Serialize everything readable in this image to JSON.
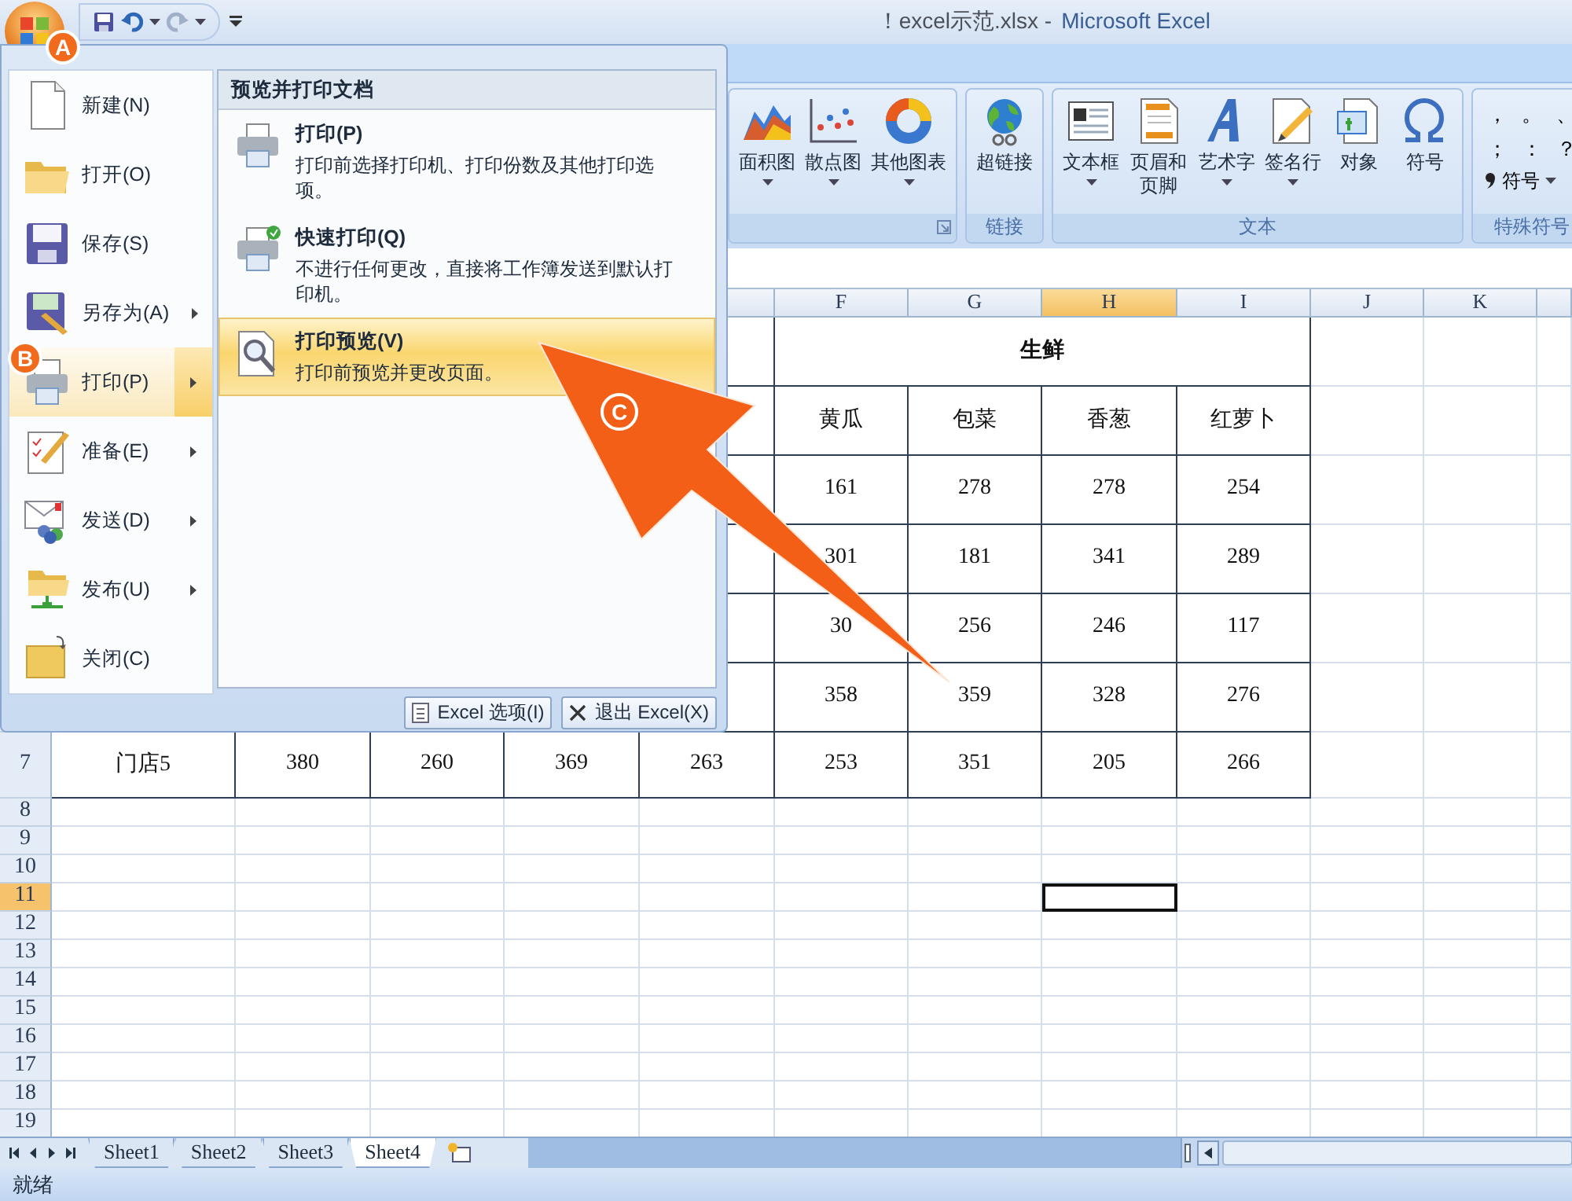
{
  "window": {
    "title_file": "！excel示范.xlsx -",
    "title_app": "Microsoft Excel"
  },
  "ribbon": {
    "groups": [
      {
        "kind": "buttons",
        "launcher": true,
        "buttons": [
          {
            "label": "面积图",
            "dropdown": true
          },
          {
            "label": "散点图",
            "dropdown": true
          },
          {
            "label": "其他图表",
            "dropdown": true
          }
        ]
      },
      {
        "kind": "buttons",
        "label": "链接",
        "buttons": [
          {
            "label": "超链接",
            "dropdown": false
          }
        ]
      },
      {
        "kind": "buttons",
        "label": "文本",
        "buttons": [
          {
            "label": "文本框",
            "dropdown": true
          },
          {
            "label": "页眉和页脚",
            "dropdown": false
          },
          {
            "label": "艺术字",
            "dropdown": true
          },
          {
            "label": "签名行",
            "dropdown": true
          },
          {
            "label": "对象",
            "dropdown": false
          },
          {
            "label": "符号",
            "dropdown": false
          }
        ]
      },
      {
        "kind": "symbols",
        "label": "特殊符号",
        "symbols": [
          "，",
          "。",
          "、",
          "；",
          "：",
          "？"
        ],
        "buttons": [
          {
            "label": "符号",
            "dropdown": true
          }
        ]
      }
    ]
  },
  "file_menu": {
    "commands": [
      {
        "label": "新建(N)",
        "submenu": false,
        "selected": false
      },
      {
        "label": "打开(O)",
        "submenu": false,
        "selected": false
      },
      {
        "label": "保存(S)",
        "submenu": false,
        "selected": false
      },
      {
        "label": "另存为(A)",
        "submenu": true,
        "selected": false
      },
      {
        "label": "打印(P)",
        "submenu": true,
        "selected": true
      },
      {
        "label": "准备(E)",
        "submenu": true,
        "selected": false
      },
      {
        "label": "发送(D)",
        "submenu": true,
        "selected": false
      },
      {
        "label": "发布(U)",
        "submenu": true,
        "selected": false
      },
      {
        "label": "关闭(C)",
        "submenu": false,
        "selected": false
      }
    ],
    "panel": {
      "heading": "预览并打印文档",
      "items": [
        {
          "title": "打印(P)",
          "description": "打印前选择打印机、打印份数及其他打印选项。",
          "selected": false
        },
        {
          "title": "快速打印(Q)",
          "description": "不进行任何更改，直接将工作簿发送到默认打印机。",
          "selected": false
        },
        {
          "title": "打印预览(V)",
          "description": "打印前预览并更改页面。",
          "selected": true
        }
      ]
    },
    "buttons": [
      "Excel 选项(I)",
      "退出 Excel(X)"
    ]
  },
  "sheet": {
    "column_headers": [
      {
        "label": "F",
        "selected": false
      },
      {
        "label": "G",
        "selected": false
      },
      {
        "label": "H",
        "selected": true
      },
      {
        "label": "I",
        "selected": false
      },
      {
        "label": "J",
        "selected": false
      },
      {
        "label": "K",
        "selected": false
      }
    ],
    "row_headers": [
      {
        "label": "7",
        "selected": false
      },
      {
        "label": "8",
        "selected": false
      },
      {
        "label": "9",
        "selected": false
      },
      {
        "label": "10",
        "selected": false
      },
      {
        "label": "11",
        "selected": true
      },
      {
        "label": "12",
        "selected": false
      },
      {
        "label": "13",
        "selected": false
      },
      {
        "label": "14",
        "selected": false
      },
      {
        "label": "15",
        "selected": false
      },
      {
        "label": "16",
        "selected": false
      },
      {
        "label": "17",
        "selected": false
      },
      {
        "label": "18",
        "selected": false
      },
      {
        "label": "19",
        "selected": false
      }
    ],
    "rows": [
      {
        "kind": "merged",
        "text": "生鲜"
      },
      {
        "kind": "cells",
        "cells": [
          null,
          null,
          null,
          null,
          null,
          "黄瓜",
          "包菜",
          "香葱",
          "红萝卜"
        ]
      },
      {
        "kind": "cells",
        "cells": [
          null,
          null,
          null,
          null,
          null,
          "161",
          "278",
          "278",
          "254"
        ]
      },
      {
        "kind": "cells",
        "cells": [
          null,
          null,
          null,
          null,
          null,
          "301",
          "181",
          "341",
          "289"
        ]
      },
      {
        "kind": "cells",
        "cells": [
          null,
          null,
          null,
          null,
          null,
          "30",
          "256",
          "246",
          "117"
        ]
      },
      {
        "kind": "cells",
        "cells": [
          null,
          null,
          null,
          null,
          null,
          "358",
          "359",
          "328",
          "276"
        ]
      },
      {
        "kind": "cells",
        "cells": [
          "门店5",
          "380",
          "260",
          "369",
          "263",
          "253",
          "351",
          "205",
          "266"
        ]
      }
    ]
  },
  "sheet_tabs": [
    {
      "label": "Sheet1",
      "selected": false
    },
    {
      "label": "Sheet2",
      "selected": false
    },
    {
      "label": "Sheet3",
      "selected": false
    },
    {
      "label": "Sheet4",
      "selected": true
    }
  ],
  "status_bar": {
    "text": "就绪"
  },
  "annotations": [
    {
      "label": "A"
    },
    {
      "label": "B"
    },
    {
      "label": "C"
    }
  ]
}
